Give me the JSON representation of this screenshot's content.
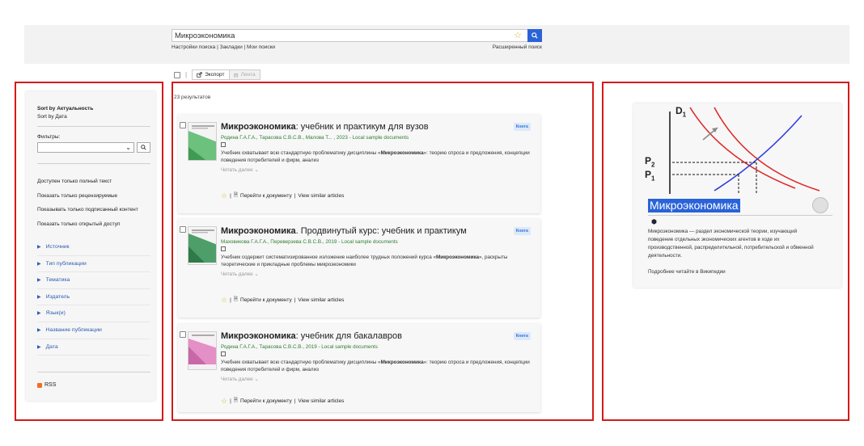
{
  "search": {
    "query": "Микроэкономика",
    "links_left": "Настройки поиска | Закладки | Мои поиски",
    "advanced": "Расширенный поиск"
  },
  "toolbar": {
    "separator": "|",
    "export_label": "Экспорт",
    "feed_label": "Лента"
  },
  "sidebar": {
    "sort_active": "Sort by Актуальность",
    "sort_alt": "Sort by Дата",
    "filters_label": "Фильтры:",
    "checkboxes": [
      "Доступен только полный текст",
      "Показать только рецензируемые",
      "Показывать только подписанный контент",
      "Показать только открытый доступ"
    ],
    "facets": [
      "Источник",
      "Тип публикации",
      "Тематика",
      "Издатель",
      "Язык(и)",
      "Название публикации",
      "Дата"
    ],
    "rss": "RSS"
  },
  "results": {
    "count": "23 результатов",
    "items": [
      {
        "title_bold": "Микроэкономика",
        "title_rest": ": учебник и практикум для вузов",
        "badge": "Книга",
        "authors": "Родина Г.А.Г.А., Тарасова С.В.С.В., Малова Т... , 2023 - Local sample documents",
        "desc_pre": "Учебник охватывает всю стандартную проблематику дисциплины «",
        "desc_bold": "Микроэкономика",
        "desc_post": "»: теорию спроса и предложения, концепции поведения потребителей и фирм, анализ",
        "more": "Читать далее ⌄",
        "goto": "Перейти к документу",
        "similar": "View similar articles",
        "thumb_color": "#6cc17c"
      },
      {
        "title_bold": "Микроэкономика",
        "title_rest": ". Продвинутый курс: учебник и практикум",
        "badge": "Книга",
        "authors": "Маховикова Г.А.Г.А., Переверзева С.В.С.В., 2019 - Local sample documents",
        "desc_pre": "Учебник содержит систематизированное изложение наиболее трудных положений курса «",
        "desc_bold": "Микроэкономика",
        "desc_post": "», раскрыты теоретические и прикладные проблемы микроэкономики",
        "more": "Читать далее ⌄",
        "goto": "Перейти к документу",
        "similar": "View similar articles",
        "thumb_color": "#4e9e6a"
      },
      {
        "title_bold": "Микроэкономика",
        "title_rest": ": учебник для бакалавров",
        "badge": "Книга",
        "authors": "Родина Г.А.Г.А., Тарасова С.В.С.В., 2019 - Local sample documents",
        "desc_pre": "Учебник охватывает всю стандартную проблематику дисциплины «",
        "desc_bold": "Микроэкономика",
        "desc_post": "»: теорию спроса и предложения, концепции поведения потребителей и фирм, анализ",
        "more": "Читать далее ⌄",
        "goto": "Перейти к документу",
        "similar": "View similar articles",
        "thumb_color": "#e48fc6"
      }
    ]
  },
  "wiki": {
    "title": "Микроэкономика",
    "text": "Микроэкономика — раздел экономической теории, изучающий поведение отдельных экономических агентов в ходе их производственной, распределительной, потребительской и обменной деятельности.",
    "more": "Подробнее читайте в Википедии",
    "graph": {
      "p2": "P",
      "p2_sub": "2",
      "p1": "P",
      "p1_sub": "1",
      "d1": "D",
      "d1_sub": "1"
    }
  },
  "colors": {
    "accent": "#2a63d8",
    "frame": "#d61919",
    "authors": "#2e7d32",
    "facet": "#2a5db0"
  }
}
